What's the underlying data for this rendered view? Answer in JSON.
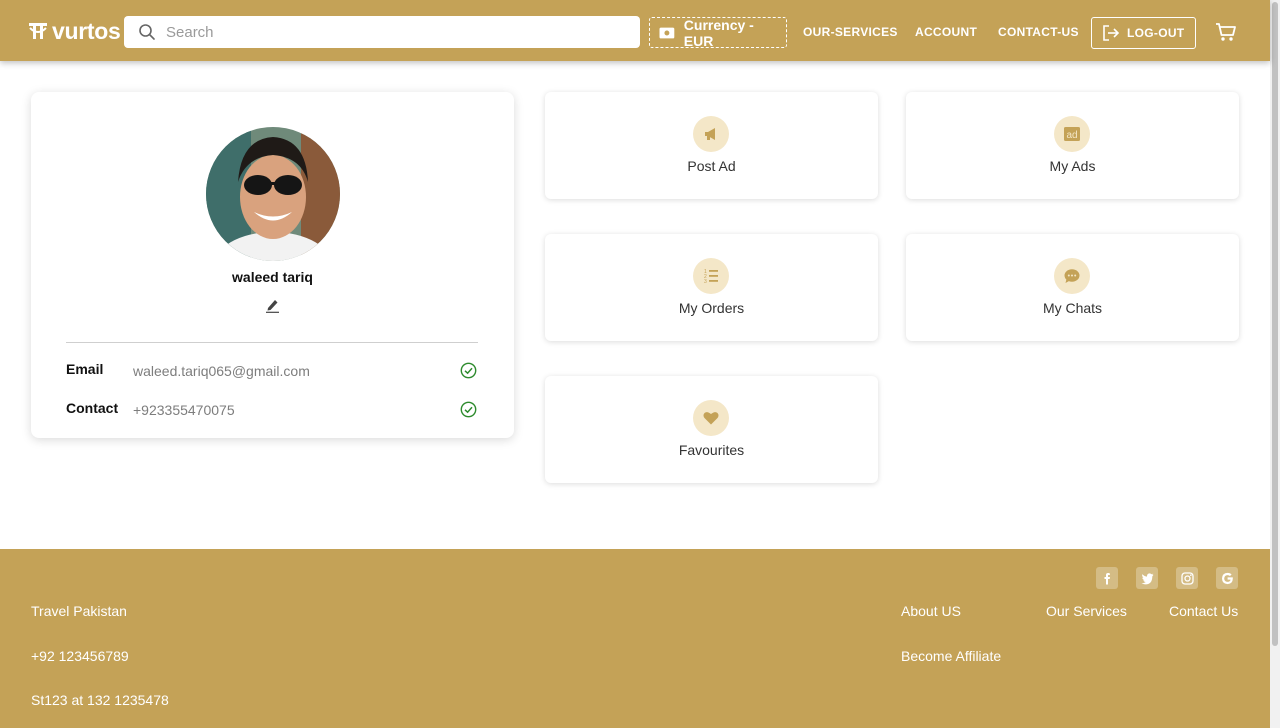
{
  "header": {
    "brand": "vurtos",
    "search_placeholder": "Search",
    "currency_label": "Currency - EUR",
    "nav": {
      "services": "OUR-SERVICES",
      "account": "ACCOUNT",
      "contact": "CONTACT-US"
    },
    "logout_label": "LOG-OUT"
  },
  "profile": {
    "name": "waleed tariq",
    "email_label": "Email",
    "email_value": "waleed.tariq065@gmail.com",
    "contact_label": "Contact",
    "contact_value": "+923355470075"
  },
  "tiles": [
    {
      "label": "Post Ad",
      "icon": "megaphone-icon"
    },
    {
      "label": "My Ads",
      "icon": "ad-icon"
    },
    {
      "label": "My Orders",
      "icon": "list-icon"
    },
    {
      "label": "My Chats",
      "icon": "chat-icon"
    },
    {
      "label": "Favourites",
      "icon": "heart-icon"
    }
  ],
  "footer": {
    "company": "Travel Pakistan",
    "phone": "+92 123456789",
    "address": "St123 at 132 1235478",
    "links": {
      "about": "About US",
      "services": "Our Services",
      "contact": "Contact Us",
      "affiliate": "Become Affiliate"
    },
    "social": [
      "facebook-icon",
      "twitter-icon",
      "instagram-icon",
      "google-icon"
    ]
  },
  "colors": {
    "brand": "#c4a257",
    "icon_bg": "#f4e7c8",
    "icon_fg": "#c4a257",
    "verified": "#2e8b2e"
  }
}
